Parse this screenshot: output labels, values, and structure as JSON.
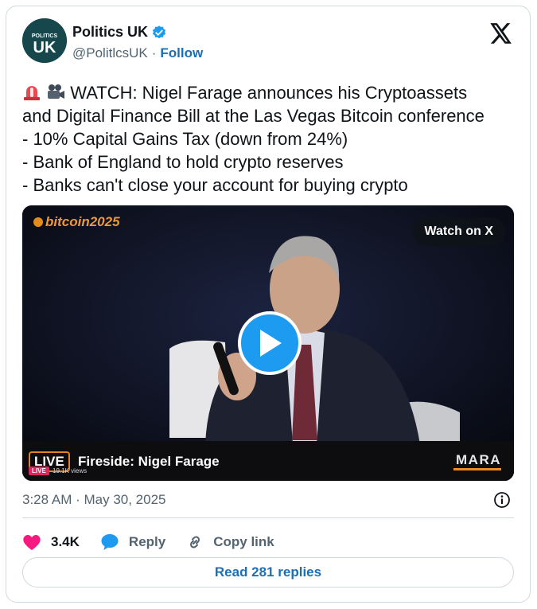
{
  "author": {
    "display_name": "Politics UK",
    "avatar_text_top": "POLITICS",
    "avatar_text_main": "UK",
    "handle": "@PolitlcsUK",
    "separator": "·",
    "follow_label": "Follow"
  },
  "tweet": {
    "headline": "WATCH: Nigel Farage announces his Cryptoassets",
    "headline_cont": "and Digital Finance Bill at the Las Vegas Bitcoin conference",
    "bullets": [
      "- 10% Capital Gains Tax (down from 24%)",
      "- Bank of England to hold crypto reserves",
      "- Banks can't close your account for buying crypto"
    ],
    "emojis": [
      "siren-icon",
      "movie-camera-icon"
    ]
  },
  "media": {
    "brand_text": "bitcoin",
    "brand_year": "2025",
    "watch_label": "Watch on X",
    "live_label": "LIVE",
    "live_small": "LIVE",
    "views": "19.1K views",
    "caption": "Fireside: Nigel Farage",
    "sponsor": "MARA"
  },
  "timestamp": "3:28 AM · May 30, 2025",
  "actions": {
    "like_count": "3.4K",
    "reply_label": "Reply",
    "copy_label": "Copy link"
  },
  "read_replies_label": "Read 281 replies",
  "colors": {
    "accent": "#1d9bf0",
    "follow": "#1d6fb5",
    "like": "#f91880",
    "avatar_bg": "#15474d"
  }
}
